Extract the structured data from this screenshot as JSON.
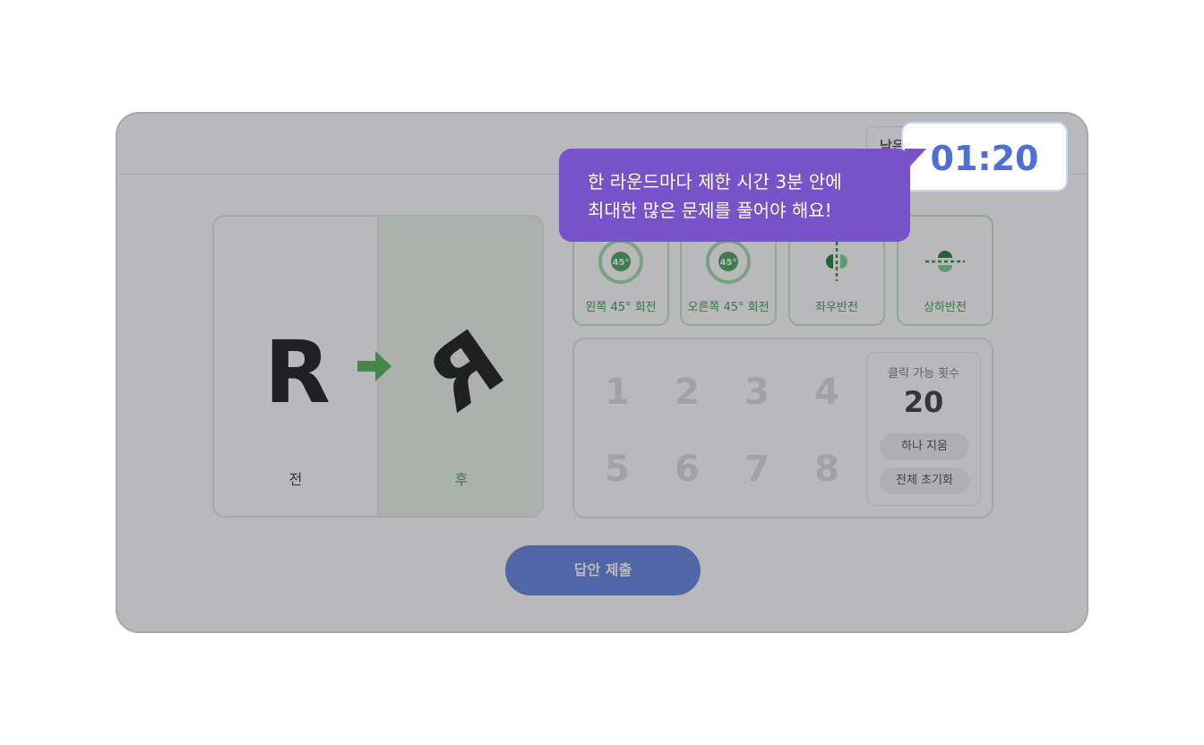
{
  "header": {
    "timer_label": "남은 시간"
  },
  "compare": {
    "before_letter": "R",
    "after_letter": "R",
    "before_label": "전",
    "after_label": "후"
  },
  "tools": [
    {
      "label": "왼쪽 45° 회전",
      "badge": "45°",
      "icon": "rotate-left-icon"
    },
    {
      "label": "오른쪽 45° 회전",
      "badge": "45°",
      "icon": "rotate-right-icon"
    },
    {
      "label": "좌우반전",
      "icon": "flip-horizontal-icon"
    },
    {
      "label": "상하반전",
      "icon": "flip-vertical-icon"
    }
  ],
  "slots": [
    "1",
    "2",
    "3",
    "4",
    "5",
    "6",
    "7",
    "8"
  ],
  "clicks": {
    "title": "클릭 가능 횟수",
    "count": "20",
    "undo_label": "하나 지움",
    "reset_label": "전체 초기화"
  },
  "submit_label": "답안 제출",
  "timer_popup": "01:20",
  "tooltip": {
    "line1": "한 라운드마다 제한 시간 3분 안에",
    "line2": "최대한 많은 문제를 풀어야 해요!"
  },
  "colors": {
    "accent_green": "#2e9a45",
    "tooltip_purple": "#7852c8",
    "timer_blue": "#4e6fd6",
    "submit_blue": "#5c7ee0"
  }
}
